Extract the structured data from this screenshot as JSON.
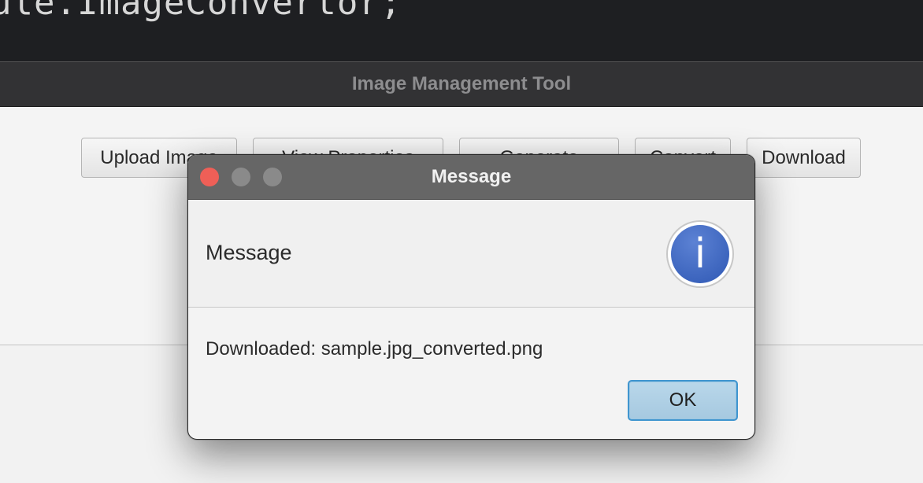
{
  "editor": {
    "code_line": "ule.ImageConvertor;"
  },
  "app": {
    "title": "Image Management Tool",
    "toolbar_buttons": [
      "Upload Image",
      "View Properties",
      "Generate",
      "Convert",
      "Download"
    ]
  },
  "dialog": {
    "title": "Message",
    "header_text": "Message",
    "icon": "info-icon",
    "icon_glyph": "i",
    "message": "Downloaded: sample.jpg_converted.png",
    "ok_label": "OK"
  }
}
